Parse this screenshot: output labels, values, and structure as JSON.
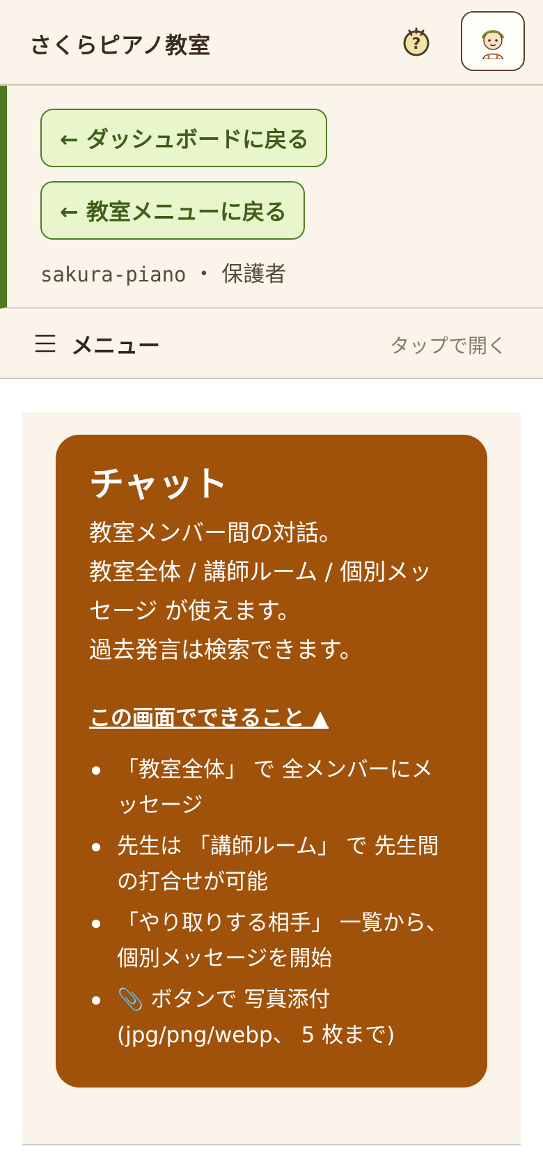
{
  "header": {
    "title": "さくらピアノ教室",
    "help_icon": "help-circle-icon",
    "avatar_icon": "user-avatar-icon"
  },
  "nav": {
    "back_dashboard": "← ダッシュボードに戻る",
    "back_classroom_menu": "← 教室メニューに戻る",
    "workspace_slug": "sakura-piano",
    "separator": "・",
    "role": "保護者"
  },
  "menu": {
    "label": "メニュー",
    "hint": "タップで開く"
  },
  "card": {
    "title": "チャット",
    "description_lines": [
      "教室メンバー間の対話。",
      "教室全体 / 講師ルーム / 個別メッセージ が使えます。",
      "過去発言は検索できます。"
    ],
    "toggle_label": "この画面でできること ▲",
    "features": [
      "「教室全体」 で 全メンバーにメッセージ",
      "先生は 「講師ルーム」 で 先生間の打合せが可能",
      "「やり取りする相手」 一覧から、 個別メッセージを開始",
      "📎 ボタンで 写真添付 (jpg/png/webp、 5 枚まで)"
    ]
  },
  "colors": {
    "card_bg": "#a0520b",
    "back_btn_bg": "#e9f6cb",
    "back_btn_border": "#4e7d22",
    "accent_bar": "#4f7a22",
    "panel_bg": "#faf4ea"
  }
}
